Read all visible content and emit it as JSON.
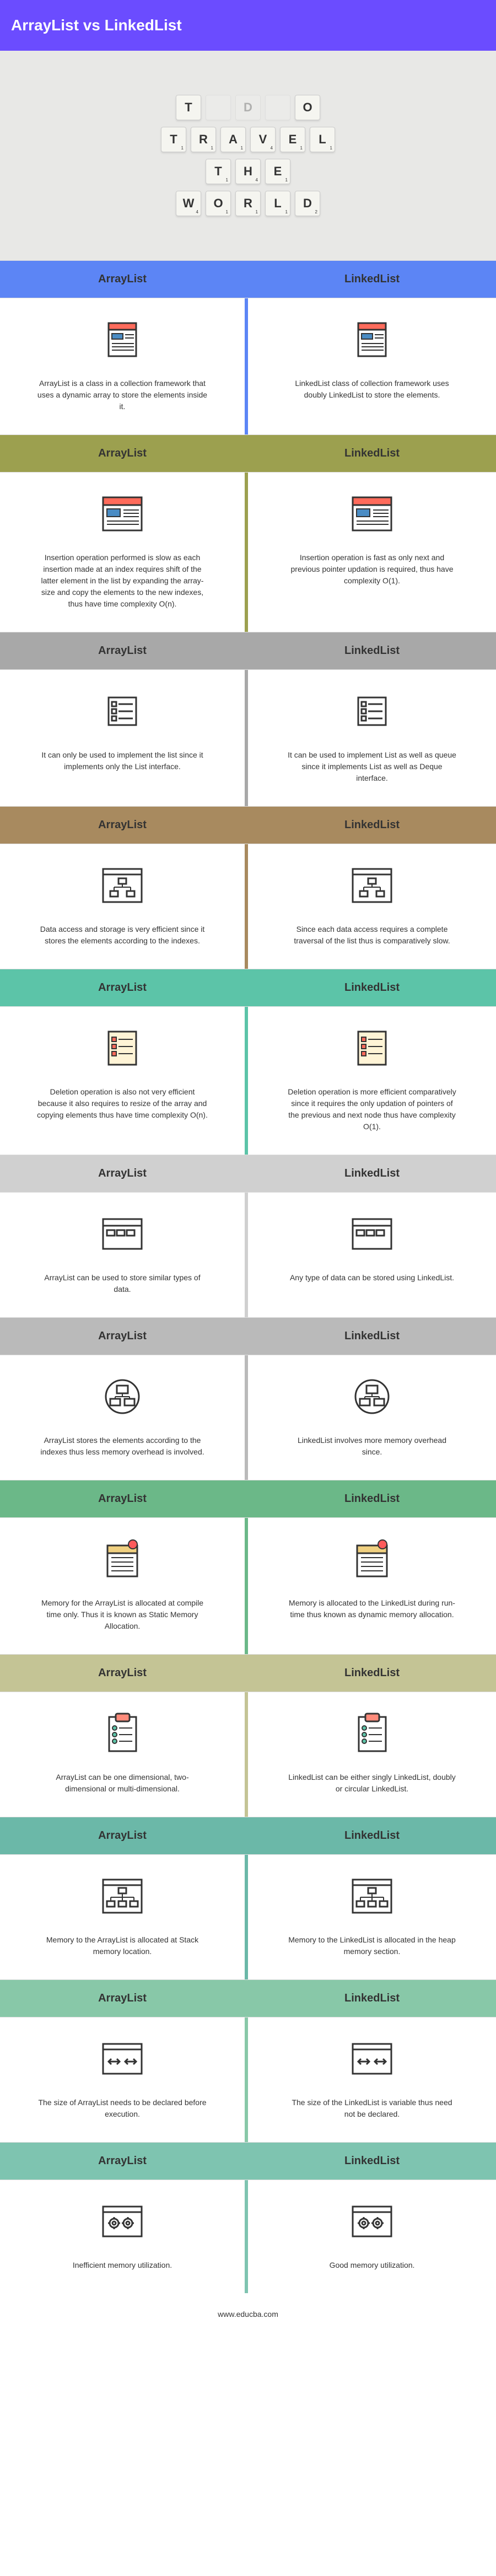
{
  "title": "ArrayList vs LinkedList",
  "leftLabel": "ArrayList",
  "rightLabel": "LinkedList",
  "footer": "www.educba.com",
  "rows": [
    {
      "left": "ArrayList is a class in a collection framework that uses a dynamic array to store the elements inside it.",
      "right": "LinkedList class of collection framework uses doubly LinkedList to store the elements."
    },
    {
      "left": "Insertion operation performed is slow as each insertion made at an index requires shift of the latter element in the list by expanding the array-size and copy the elements to the new indexes, thus have time complexity O(n).",
      "right": "Insertion operation is fast as only next and previous pointer updation is required, thus have complexity O(1)."
    },
    {
      "left": "It can only be used to implement the list since it implements only the List interface.",
      "right": "It can be used to implement List as well as queue since it implements List as well as Deque interface."
    },
    {
      "left": "Data access and storage is very efficient since it stores the elements according to the indexes.",
      "right": "Since each data access requires a complete traversal of the list thus is comparatively slow."
    },
    {
      "left": "Deletion operation is also not very efficient because it also requires to resize of the array and copying elements thus have time complexity O(n).",
      "right": "Deletion operation is more efficient comparatively since it requires the only updation of pointers of the previous and next node thus have complexity O(1)."
    },
    {
      "left": "ArrayList can be used to store similar types of data.",
      "right": "Any type of data can be stored using LinkedList."
    },
    {
      "left": "ArrayList stores the elements according to the indexes thus less memory overhead is involved.",
      "right": "LinkedList involves more memory overhead since."
    },
    {
      "left": "Memory for the ArrayList is allocated at compile time only. Thus it is known as Static Memory Allocation.",
      "right": "Memory is allocated to the LinkedList during run-time thus known as dynamic memory allocation."
    },
    {
      "left": "ArrayList can be one dimensional, two-dimensional or multi-dimensional.",
      "right": "LinkedList can be either singly LinkedList, doubly or circular LinkedList."
    },
    {
      "left": "Memory to the ArrayList is allocated at Stack memory location.",
      "right": "Memory to the LinkedList is allocated in the heap memory section."
    },
    {
      "left": "The size of ArrayList needs to be declared before execution.",
      "right": "The size of the LinkedList is variable thus need not be declared."
    },
    {
      "left": "Inefficient memory utilization.",
      "right": "Good memory utilization."
    }
  ],
  "colors": [
    "blue",
    "olive",
    "gray",
    "brown",
    "teal",
    "ltgray",
    "dkgray",
    "green",
    "ltolive",
    "teal2",
    "mint",
    "seafoam"
  ],
  "icons": [
    "doc",
    "browser",
    "list",
    "tree",
    "checklist",
    "window",
    "circle",
    "calendar",
    "clipboard",
    "tree2",
    "resize",
    "gears"
  ]
}
